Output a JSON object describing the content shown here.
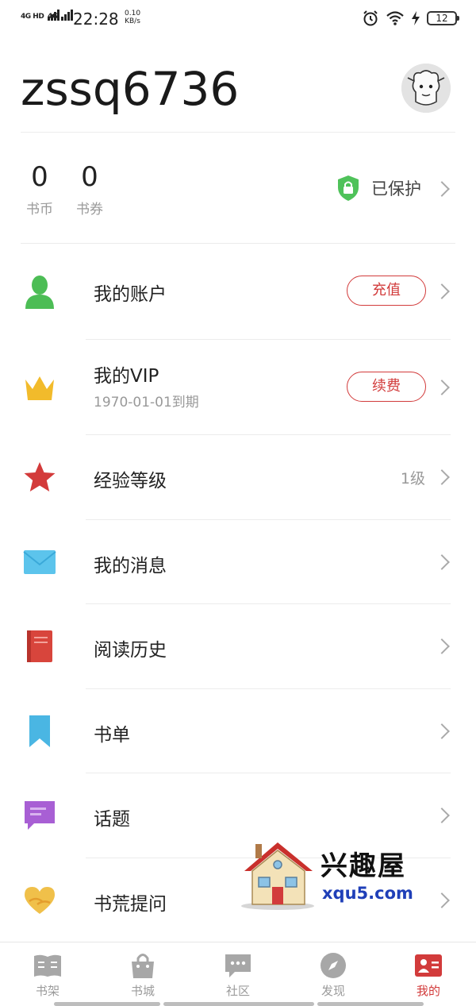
{
  "status_bar": {
    "signal1": "4G HD",
    "signal2": "4G",
    "time": "22:28",
    "speed_value": "0.10",
    "speed_unit": "KB/s",
    "battery": "12"
  },
  "profile": {
    "username": "zssq6736"
  },
  "stats": [
    {
      "value": "0",
      "label": "书币"
    },
    {
      "value": "0",
      "label": "书券"
    }
  ],
  "protection": {
    "label": "已保护"
  },
  "menu": [
    {
      "title": "我的账户",
      "button": "充值",
      "icon": "person-icon"
    },
    {
      "title": "我的VIP",
      "subtitle": "1970-01-01到期",
      "button": "续费",
      "icon": "crown-icon"
    },
    {
      "title": "经验等级",
      "value": "1级",
      "icon": "star-icon"
    },
    {
      "title": "我的消息",
      "icon": "envelope-icon"
    },
    {
      "title": "阅读历史",
      "icon": "book-icon"
    },
    {
      "title": "书单",
      "icon": "bookmark-icon"
    },
    {
      "title": "话题",
      "icon": "chat-bubble-icon"
    },
    {
      "title": "书荒提问",
      "icon": "heart-hands-icon"
    }
  ],
  "watermark": {
    "title": "兴趣屋",
    "url": "xqu5.com"
  },
  "nav": [
    {
      "label": "书架",
      "icon": "bookshelf-icon"
    },
    {
      "label": "书城",
      "icon": "shopping-bag-icon"
    },
    {
      "label": "社区",
      "icon": "community-chat-icon"
    },
    {
      "label": "发现",
      "icon": "compass-icon"
    },
    {
      "label": "我的",
      "icon": "profile-card-icon",
      "active": true
    }
  ],
  "colors": {
    "accent": "#d23b3b",
    "inactive": "#9b9b9b"
  }
}
